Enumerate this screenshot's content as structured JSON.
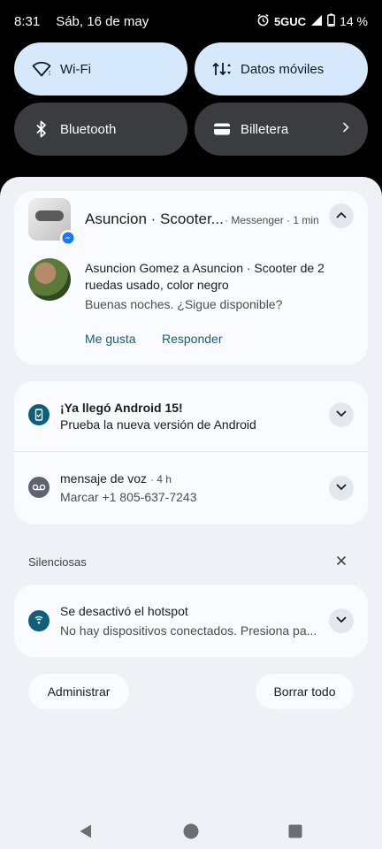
{
  "status_bar": {
    "time": "8:31",
    "date": "Sáb, 16 de may",
    "network": "5GUC",
    "battery": "14 %",
    "icons": [
      "alarm-icon",
      "signal-icon",
      "battery-icon"
    ]
  },
  "quick_settings": {
    "tiles": [
      {
        "label": "Wi-Fi",
        "icon": "wifi-icon",
        "state": "on"
      },
      {
        "label": "Datos móviles",
        "icon": "mobile-data-icon",
        "state": "on"
      },
      {
        "label": "Bluetooth",
        "icon": "bluetooth-icon",
        "state": "off"
      },
      {
        "label": "Billetera",
        "icon": "wallet-icon",
        "state": "off"
      }
    ]
  },
  "notifications": {
    "messenger": {
      "title": "Asuncion · Scooter...",
      "app_meta": "· Messenger · 1 min",
      "sender_line": "Asuncion Gomez a Asuncion · Scooter de 2 ruedas usado, color negro",
      "message": "Buenas noches. ¿Sigue disponible?",
      "actions": [
        "Me gusta",
        "Responder"
      ]
    },
    "android": {
      "title": "¡Ya llegó Android 15!",
      "subtitle": "Prueba la nueva versión de Android"
    },
    "voicemail": {
      "title": "mensaje de voz",
      "meta": "· 4 h",
      "subtitle": "Marcar +1 805-637-7243"
    },
    "silent_section": {
      "label": "Silenciosas"
    },
    "hotspot": {
      "title": "Se desactivó el hotspot",
      "subtitle": "No hay dispositivos conectados. Presiona pa..."
    }
  },
  "footer_buttons": {
    "manage": "Administrar",
    "clear_all": "Borrar todo"
  },
  "colors": {
    "accent": "#0e5f84",
    "tile_on": "#d6e8fb",
    "tile_off": "#3a3c40",
    "shade_bg": "#eef1f6"
  }
}
